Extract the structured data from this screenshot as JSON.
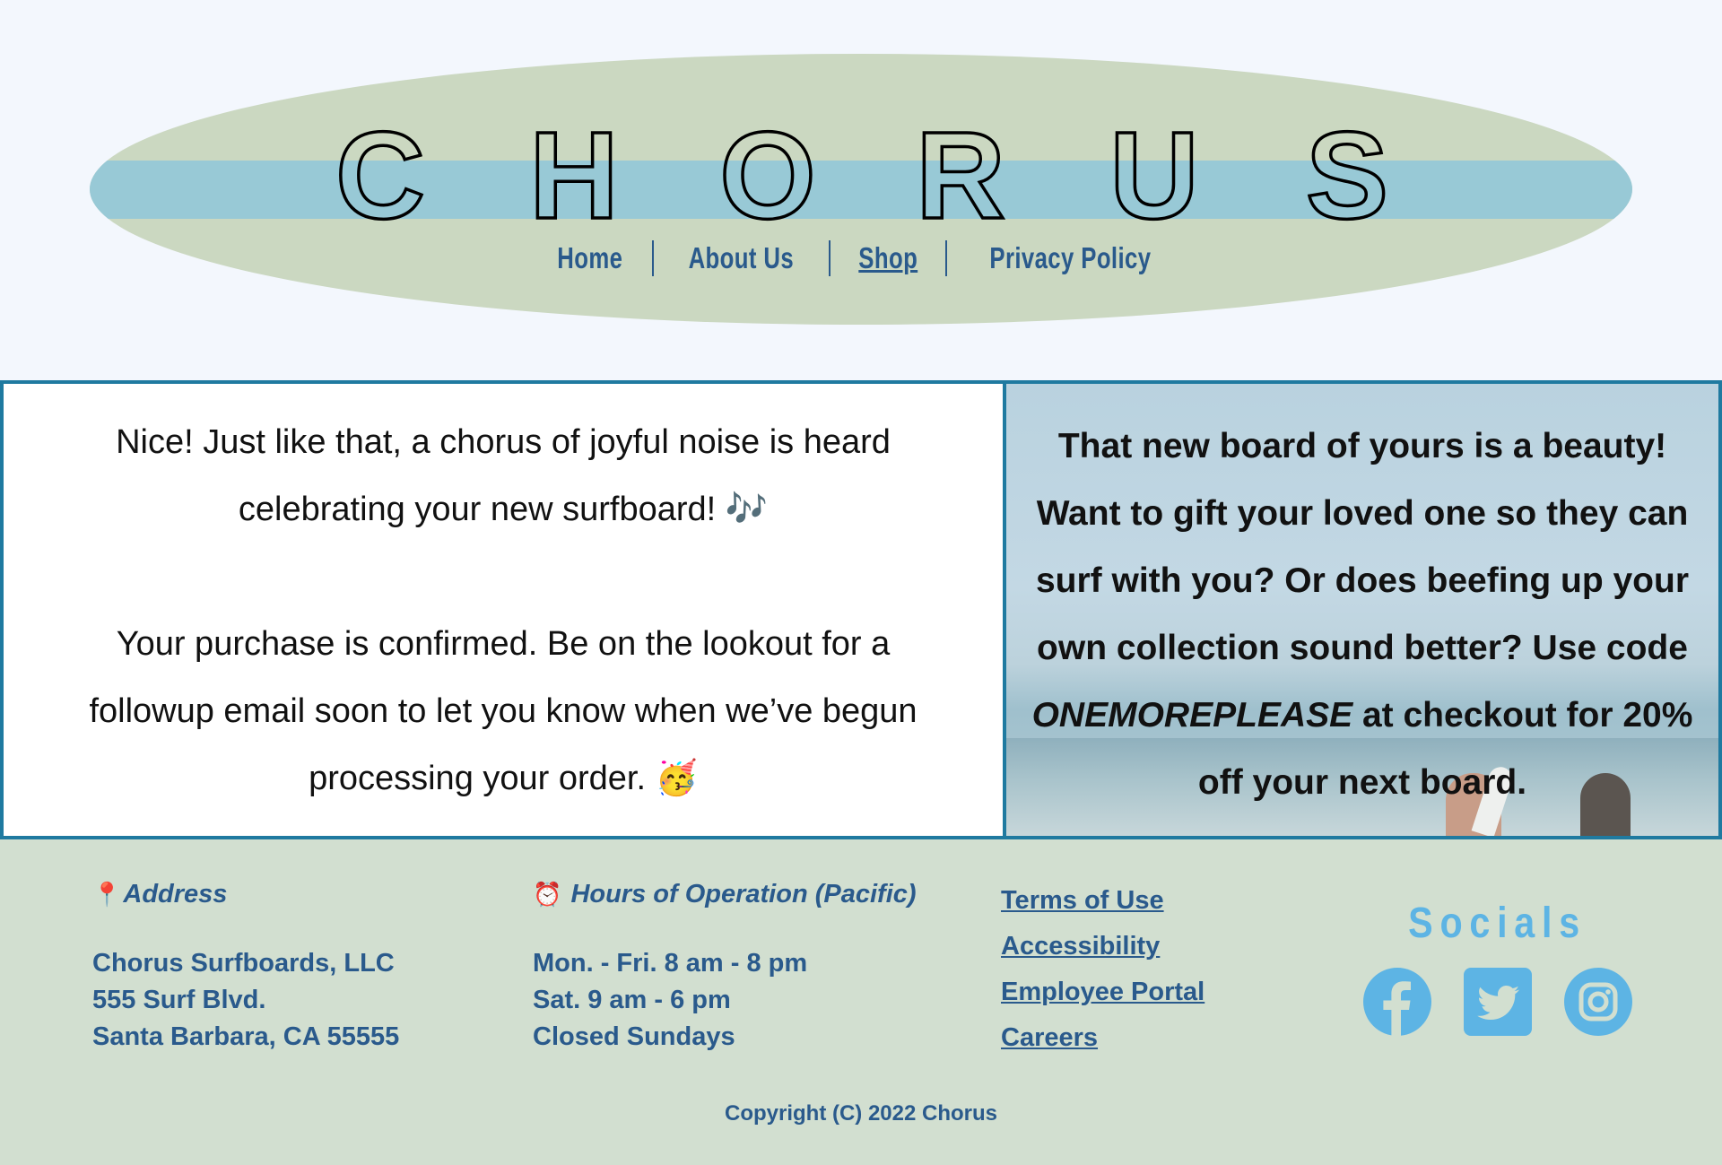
{
  "header": {
    "logo_letters": [
      "C",
      "H",
      "O",
      "R",
      "U",
      "S"
    ],
    "nav": [
      {
        "label": "Home",
        "active": false
      },
      {
        "label": "About Us",
        "active": false
      },
      {
        "label": "Shop",
        "active": true
      },
      {
        "label": "Privacy Policy",
        "active": false
      }
    ]
  },
  "confirmation": {
    "paragraph1": "Nice! Just like that, a chorus of joyful noise is heard celebrating your new surfboard! 🎶",
    "paragraph2": "Your purchase is confirmed. Be on the lookout for a followup email soon to let you know when we’ve begun processing your order. 🥳"
  },
  "promo": {
    "text_before": "That new board of yours is a beauty! Want to gift your loved one so they can surf with you? Or does beefing up your own collection sound better? Use code ",
    "code": "ONEMOREPLEASE",
    "text_after": " at checkout for 20% off your next board."
  },
  "footer": {
    "address": {
      "icon": "📍",
      "title": "Address",
      "lines": [
        "Chorus Surfboards, LLC",
        "555 Surf Blvd.",
        "Santa Barbara, CA 55555"
      ]
    },
    "hours": {
      "icon": "⏰",
      "title": "Hours of Operation (Pacific)",
      "lines": [
        "Mon. - Fri. 8 am - 8 pm",
        "Sat. 9 am - 6 pm",
        "Closed Sundays"
      ]
    },
    "links": [
      "Terms of Use",
      "Accessibility",
      "Employee Portal",
      "Careers"
    ],
    "socials": {
      "title": "Socials",
      "icons": [
        "facebook-icon",
        "twitter-icon",
        "instagram-icon"
      ],
      "color": "#5db4e4"
    },
    "copyright": "Copyright (C) 2022 Chorus"
  },
  "colors": {
    "page_bg": "#f3f7fd",
    "board_green": "#cbd8c1",
    "board_stripe": "#98c9d6",
    "nav_text": "#2a5a8c",
    "main_border": "#1f7aa0",
    "footer_bg": "#d2dfd0"
  }
}
